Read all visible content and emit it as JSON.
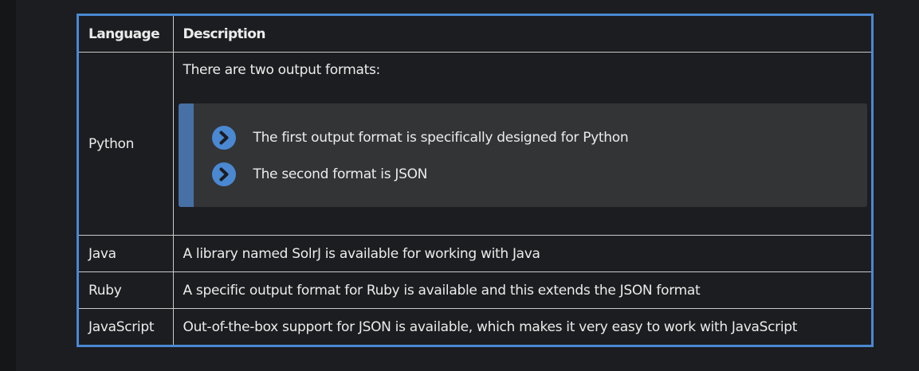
{
  "table": {
    "headers": {
      "language": "Language",
      "description": "Description"
    },
    "rows": [
      {
        "language": "Python",
        "intro": "There are two output formats:",
        "bullets": [
          "The first output format is specifically designed for Python",
          "The second format is JSON"
        ]
      },
      {
        "language": "Java",
        "description": "A library named SolrJ is available for working with Java"
      },
      {
        "language": "Ruby",
        "description": "A specific output format for Ruby is available and this extends the JSON format"
      },
      {
        "language": "JavaScript",
        "description": "Out-of-the-box support for JSON is available, which makes it very easy to work with JavaScript"
      }
    ]
  },
  "icons": {
    "bullet": "chevron-right-circle-icon"
  },
  "colors": {
    "accent": "#4a88d2",
    "callout_bar": "#4670a6",
    "callout_bg": "#333436",
    "background": "#1c1d20"
  }
}
